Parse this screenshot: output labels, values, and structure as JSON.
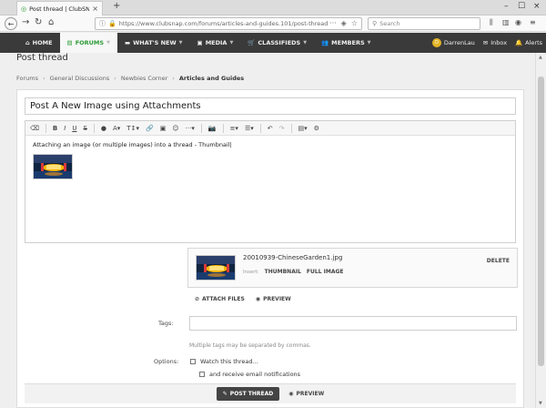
{
  "browser": {
    "tab_title": "Post thread | ClubSNAP Photo...",
    "url": "https://www.clubsnap.com/forums/articles-and-guides.101/post-thread",
    "search_placeholder": "Search"
  },
  "site_nav": {
    "items": [
      {
        "label": "HOME",
        "icon": "home-icon"
      },
      {
        "label": "FORUMS",
        "icon": "forums-icon"
      },
      {
        "label": "WHAT'S NEW",
        "icon": "comment-icon"
      },
      {
        "label": "MEDIA",
        "icon": "image-icon"
      },
      {
        "label": "CLASSIFIEDS",
        "icon": "cart-icon"
      },
      {
        "label": "MEMBERS",
        "icon": "users-icon"
      }
    ],
    "user": "DarrenLau",
    "inbox": "Inbox",
    "alerts": "Alerts"
  },
  "page": {
    "title": "Post thread",
    "breadcrumb": [
      "Forums",
      "General Discussions",
      "Newbies Corner",
      "Articles and Guides"
    ]
  },
  "form": {
    "thread_title": "Post A New Image using Attachments",
    "editor_text": "Attaching an image (or multiple images) into a thread - Thumbnail",
    "attachment": {
      "filename": "20010939-ChineseGarden1.jpg",
      "insert_label": "Insert:",
      "thumbnail_label": "THUMBNAIL",
      "full_image_label": "FULL IMAGE",
      "delete_label": "DELETE"
    },
    "attach_files_label": "ATTACH FILES",
    "preview_label": "PREVIEW",
    "tags_label": "Tags:",
    "tags_hint": "Multiple tags may be separated by commas.",
    "options_label": "Options:",
    "watch_label": "Watch this thread...",
    "email_label": "and receive email notifications",
    "submit_label": "POST THREAD",
    "bottom_preview_label": "PREVIEW"
  },
  "colors": {
    "header_bg": "#3a3a3a",
    "accent_green": "#2c9b36",
    "button_dark": "#444444"
  }
}
